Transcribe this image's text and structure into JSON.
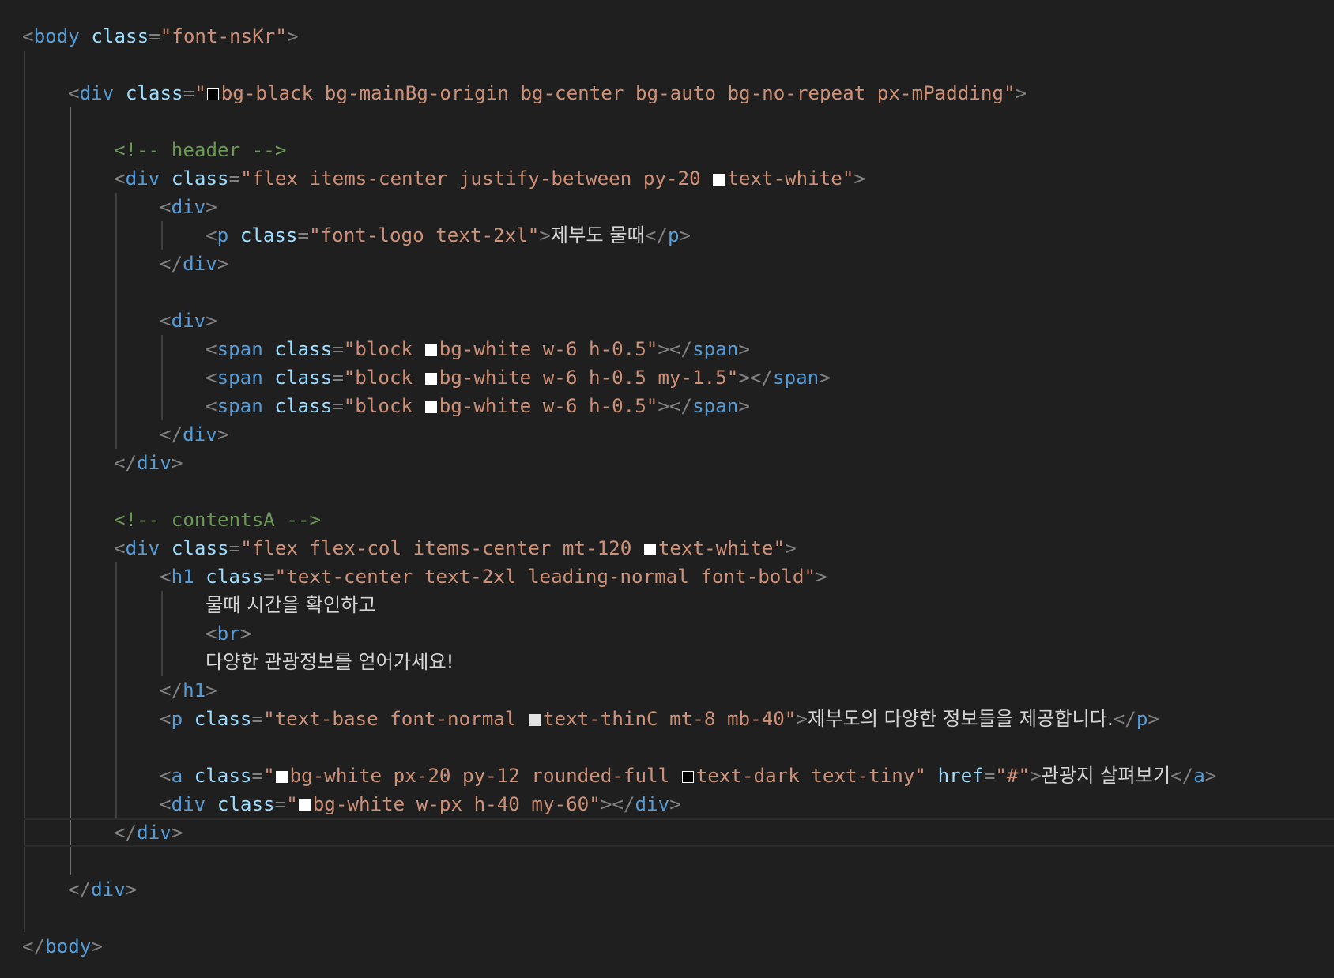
{
  "editor": {
    "lines": [
      {
        "row": 0,
        "indent": 0,
        "tokens": [
          {
            "k": "p",
            "v": "<"
          },
          {
            "k": "t",
            "v": "body"
          },
          {
            "k": "sp",
            "v": " "
          },
          {
            "k": "a",
            "v": "class"
          },
          {
            "k": "p",
            "v": "="
          },
          {
            "k": "s",
            "v": "\"font-nsKr\""
          },
          {
            "k": "p",
            "v": ">"
          }
        ]
      },
      {
        "row": 2,
        "indent": 1,
        "tokens": [
          {
            "k": "p",
            "v": "<"
          },
          {
            "k": "t",
            "v": "div"
          },
          {
            "k": "sp",
            "v": " "
          },
          {
            "k": "a",
            "v": "class"
          },
          {
            "k": "p",
            "v": "="
          },
          {
            "k": "s",
            "v": "\""
          },
          {
            "k": "swatch",
            "color": "black"
          },
          {
            "k": "s",
            "v": "bg-black bg-mainBg-origin bg-center bg-auto bg-no-repeat px-mPadding\""
          },
          {
            "k": "p",
            "v": ">"
          }
        ]
      },
      {
        "row": 4,
        "indent": 2,
        "tokens": [
          {
            "k": "c",
            "v": "<!-- header -->"
          }
        ]
      },
      {
        "row": 5,
        "indent": 2,
        "tokens": [
          {
            "k": "p",
            "v": "<"
          },
          {
            "k": "t",
            "v": "div"
          },
          {
            "k": "sp",
            "v": " "
          },
          {
            "k": "a",
            "v": "class"
          },
          {
            "k": "p",
            "v": "="
          },
          {
            "k": "s",
            "v": "\"flex items-center justify-between py-20 "
          },
          {
            "k": "swatch",
            "color": "white"
          },
          {
            "k": "s",
            "v": "text-white\""
          },
          {
            "k": "p",
            "v": ">"
          }
        ]
      },
      {
        "row": 6,
        "indent": 3,
        "tokens": [
          {
            "k": "p",
            "v": "<"
          },
          {
            "k": "t",
            "v": "div"
          },
          {
            "k": "p",
            "v": ">"
          }
        ]
      },
      {
        "row": 7,
        "indent": 4,
        "tokens": [
          {
            "k": "p",
            "v": "<"
          },
          {
            "k": "t",
            "v": "p"
          },
          {
            "k": "sp",
            "v": " "
          },
          {
            "k": "a",
            "v": "class"
          },
          {
            "k": "p",
            "v": "="
          },
          {
            "k": "s",
            "v": "\"font-logo text-2xl\""
          },
          {
            "k": "p",
            "v": ">"
          },
          {
            "k": "tx",
            "v": "제부도 물때"
          },
          {
            "k": "p",
            "v": "</"
          },
          {
            "k": "t",
            "v": "p"
          },
          {
            "k": "p",
            "v": ">"
          }
        ]
      },
      {
        "row": 8,
        "indent": 3,
        "tokens": [
          {
            "k": "p",
            "v": "</"
          },
          {
            "k": "t",
            "v": "div"
          },
          {
            "k": "p",
            "v": ">"
          }
        ]
      },
      {
        "row": 10,
        "indent": 3,
        "tokens": [
          {
            "k": "p",
            "v": "<"
          },
          {
            "k": "t",
            "v": "div"
          },
          {
            "k": "p",
            "v": ">"
          }
        ]
      },
      {
        "row": 11,
        "indent": 4,
        "tokens": [
          {
            "k": "p",
            "v": "<"
          },
          {
            "k": "t",
            "v": "span"
          },
          {
            "k": "sp",
            "v": " "
          },
          {
            "k": "a",
            "v": "class"
          },
          {
            "k": "p",
            "v": "="
          },
          {
            "k": "s",
            "v": "\"block "
          },
          {
            "k": "swatch",
            "color": "white"
          },
          {
            "k": "s",
            "v": "bg-white w-6 h-0.5\""
          },
          {
            "k": "p",
            "v": "></"
          },
          {
            "k": "t",
            "v": "span"
          },
          {
            "k": "p",
            "v": ">"
          }
        ]
      },
      {
        "row": 12,
        "indent": 4,
        "tokens": [
          {
            "k": "p",
            "v": "<"
          },
          {
            "k": "t",
            "v": "span"
          },
          {
            "k": "sp",
            "v": " "
          },
          {
            "k": "a",
            "v": "class"
          },
          {
            "k": "p",
            "v": "="
          },
          {
            "k": "s",
            "v": "\"block "
          },
          {
            "k": "swatch",
            "color": "white"
          },
          {
            "k": "s",
            "v": "bg-white w-6 h-0.5 my-1.5\""
          },
          {
            "k": "p",
            "v": "></"
          },
          {
            "k": "t",
            "v": "span"
          },
          {
            "k": "p",
            "v": ">"
          }
        ]
      },
      {
        "row": 13,
        "indent": 4,
        "tokens": [
          {
            "k": "p",
            "v": "<"
          },
          {
            "k": "t",
            "v": "span"
          },
          {
            "k": "sp",
            "v": " "
          },
          {
            "k": "a",
            "v": "class"
          },
          {
            "k": "p",
            "v": "="
          },
          {
            "k": "s",
            "v": "\"block "
          },
          {
            "k": "swatch",
            "color": "white"
          },
          {
            "k": "s",
            "v": "bg-white w-6 h-0.5\""
          },
          {
            "k": "p",
            "v": "></"
          },
          {
            "k": "t",
            "v": "span"
          },
          {
            "k": "p",
            "v": ">"
          }
        ]
      },
      {
        "row": 14,
        "indent": 3,
        "tokens": [
          {
            "k": "p",
            "v": "</"
          },
          {
            "k": "t",
            "v": "div"
          },
          {
            "k": "p",
            "v": ">"
          }
        ]
      },
      {
        "row": 15,
        "indent": 2,
        "tokens": [
          {
            "k": "p",
            "v": "</"
          },
          {
            "k": "t",
            "v": "div"
          },
          {
            "k": "p",
            "v": ">"
          }
        ]
      },
      {
        "row": 17,
        "indent": 2,
        "tokens": [
          {
            "k": "c",
            "v": "<!-- contentsA -->"
          }
        ]
      },
      {
        "row": 18,
        "indent": 2,
        "tokens": [
          {
            "k": "p",
            "v": "<"
          },
          {
            "k": "t",
            "v": "div"
          },
          {
            "k": "sp",
            "v": " "
          },
          {
            "k": "a",
            "v": "class"
          },
          {
            "k": "p",
            "v": "="
          },
          {
            "k": "s",
            "v": "\"flex flex-col items-center mt-120 "
          },
          {
            "k": "swatch",
            "color": "white"
          },
          {
            "k": "s",
            "v": "text-white\""
          },
          {
            "k": "p",
            "v": ">"
          }
        ]
      },
      {
        "row": 19,
        "indent": 3,
        "tokens": [
          {
            "k": "p",
            "v": "<"
          },
          {
            "k": "t",
            "v": "h1"
          },
          {
            "k": "sp",
            "v": " "
          },
          {
            "k": "a",
            "v": "class"
          },
          {
            "k": "p",
            "v": "="
          },
          {
            "k": "s",
            "v": "\"text-center text-2xl leading-normal font-bold\""
          },
          {
            "k": "p",
            "v": ">"
          }
        ]
      },
      {
        "row": 20,
        "indent": 4,
        "tokens": [
          {
            "k": "tx",
            "v": "물때 시간을 확인하고"
          }
        ]
      },
      {
        "row": 21,
        "indent": 4,
        "tokens": [
          {
            "k": "p",
            "v": "<"
          },
          {
            "k": "t",
            "v": "br"
          },
          {
            "k": "p",
            "v": ">"
          }
        ]
      },
      {
        "row": 22,
        "indent": 4,
        "tokens": [
          {
            "k": "tx",
            "v": "다양한 관광정보를 얻어가세요!"
          }
        ]
      },
      {
        "row": 23,
        "indent": 3,
        "tokens": [
          {
            "k": "p",
            "v": "</"
          },
          {
            "k": "t",
            "v": "h1"
          },
          {
            "k": "p",
            "v": ">"
          }
        ]
      },
      {
        "row": 24,
        "indent": 3,
        "tokens": [
          {
            "k": "p",
            "v": "<"
          },
          {
            "k": "t",
            "v": "p"
          },
          {
            "k": "sp",
            "v": " "
          },
          {
            "k": "a",
            "v": "class"
          },
          {
            "k": "p",
            "v": "="
          },
          {
            "k": "s",
            "v": "\"text-base font-normal "
          },
          {
            "k": "swatch",
            "color": "grey"
          },
          {
            "k": "s",
            "v": "text-thinC mt-8 mb-40\""
          },
          {
            "k": "p",
            "v": ">"
          },
          {
            "k": "tx",
            "v": "제부도의 다양한 정보들을 제공합니다."
          },
          {
            "k": "p",
            "v": "</"
          },
          {
            "k": "t",
            "v": "p"
          },
          {
            "k": "p",
            "v": ">"
          }
        ]
      },
      {
        "row": 26,
        "indent": 3,
        "tokens": [
          {
            "k": "p",
            "v": "<"
          },
          {
            "k": "t",
            "v": "a"
          },
          {
            "k": "sp",
            "v": " "
          },
          {
            "k": "a",
            "v": "class"
          },
          {
            "k": "p",
            "v": "="
          },
          {
            "k": "s",
            "v": "\""
          },
          {
            "k": "swatch",
            "color": "white"
          },
          {
            "k": "s",
            "v": "bg-white px-20 py-12 rounded-full "
          },
          {
            "k": "swatch",
            "color": "black"
          },
          {
            "k": "s",
            "v": "text-dark text-tiny\""
          },
          {
            "k": "sp",
            "v": " "
          },
          {
            "k": "a",
            "v": "href"
          },
          {
            "k": "p",
            "v": "="
          },
          {
            "k": "s",
            "v": "\"#\""
          },
          {
            "k": "p",
            "v": ">"
          },
          {
            "k": "tx",
            "v": "관광지 살펴보기"
          },
          {
            "k": "p",
            "v": "</"
          },
          {
            "k": "t",
            "v": "a"
          },
          {
            "k": "p",
            "v": ">"
          }
        ]
      },
      {
        "row": 27,
        "indent": 3,
        "tokens": [
          {
            "k": "p",
            "v": "<"
          },
          {
            "k": "t",
            "v": "div"
          },
          {
            "k": "sp",
            "v": " "
          },
          {
            "k": "a",
            "v": "class"
          },
          {
            "k": "p",
            "v": "="
          },
          {
            "k": "s",
            "v": "\""
          },
          {
            "k": "swatch",
            "color": "white"
          },
          {
            "k": "s",
            "v": "bg-white w-px h-40 my-60\""
          },
          {
            "k": "p",
            "v": "></"
          },
          {
            "k": "t",
            "v": "div"
          },
          {
            "k": "p",
            "v": ">"
          }
        ]
      },
      {
        "row": 28,
        "indent": 2,
        "current": true,
        "tokens": [
          {
            "k": "p",
            "v": "</"
          },
          {
            "k": "t",
            "v": "div"
          },
          {
            "k": "p",
            "v": ">"
          }
        ]
      },
      {
        "row": 30,
        "indent": 1,
        "tokens": [
          {
            "k": "p",
            "v": "</"
          },
          {
            "k": "t",
            "v": "div"
          },
          {
            "k": "p",
            "v": ">"
          }
        ]
      },
      {
        "row": 32,
        "indent": 0,
        "tokens": [
          {
            "k": "p",
            "v": "</"
          },
          {
            "k": "t",
            "v": "body"
          },
          {
            "k": "p",
            "v": ">"
          }
        ]
      }
    ],
    "guides": [
      {
        "col": 0,
        "from": 1,
        "to": 31,
        "active": false
      },
      {
        "col": 1,
        "from": 3,
        "to": 29,
        "active": true
      },
      {
        "col": 2,
        "from": 6,
        "to": 14,
        "active": false
      },
      {
        "col": 3,
        "from": 7,
        "to": 7,
        "active": false
      },
      {
        "col": 3,
        "from": 11,
        "to": 13,
        "active": false
      },
      {
        "col": 2,
        "from": 19,
        "to": 27,
        "active": false
      },
      {
        "col": 3,
        "from": 20,
        "to": 22,
        "active": false
      }
    ]
  }
}
